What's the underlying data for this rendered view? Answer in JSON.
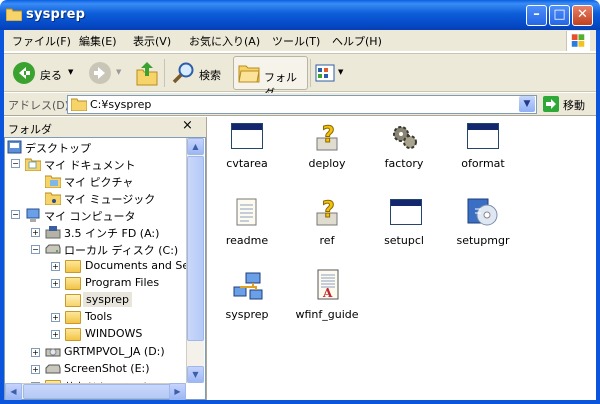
{
  "window": {
    "title": "sysprep"
  },
  "menu": [
    "ファイル(F)",
    "編集(E)",
    "表示(V)",
    "お気に入り(A)",
    "ツール(T)",
    "ヘルプ(H)"
  ],
  "toolbar": {
    "back": "戻る",
    "search": "検索",
    "folders": "フォルダ"
  },
  "address": {
    "label": "アドレス(D)",
    "value": "C:¥sysprep",
    "go": "移動"
  },
  "panel": {
    "title": "フォルダ",
    "close": "×"
  },
  "tree": [
    "デスクトップ",
    "マイ ドキュメント",
    "マイ ピクチャ",
    "マイ ミュージック",
    "マイ コンピュータ",
    "3.5 インチ FD (A:)",
    "ローカル ディスク (C:)",
    "Documents and Setti",
    "Program Files",
    "sysprep",
    "Tools",
    "WINDOWS",
    "GRTMPVOL_JA (D:)",
    "ScreenShot (E:)",
    "共有ドキュメント"
  ],
  "files": [
    "cvtarea",
    "deploy",
    "factory",
    "oformat",
    "readme",
    "ref",
    "setupcl",
    "setupmgr",
    "sysprep",
    "wfinf_guide"
  ],
  "colors": {
    "titlebar": "#0a5fe3",
    "chrome": "#ece9d8",
    "selection": "#e8e6dc"
  }
}
